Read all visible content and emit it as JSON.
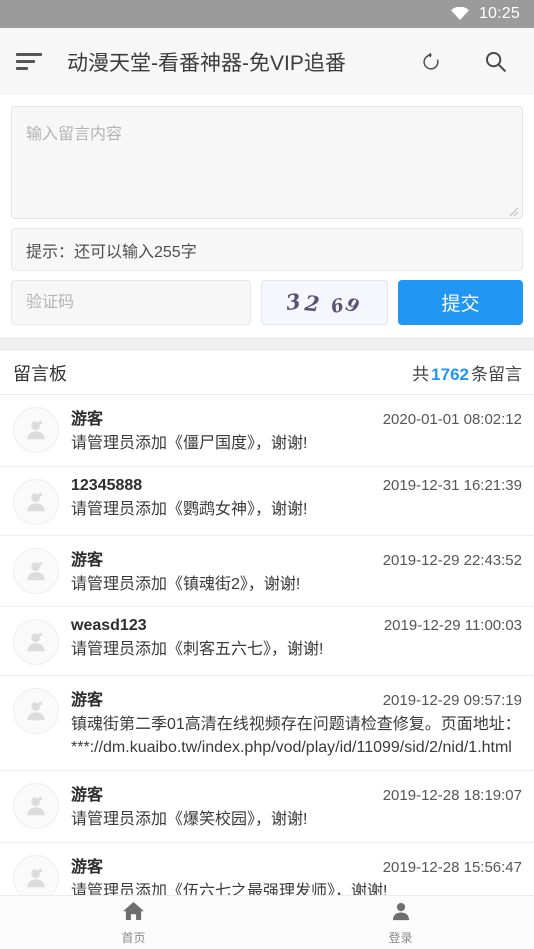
{
  "statusbar": {
    "time": "10:25",
    "wifi_icon": "wifi-icon",
    "bg_color": "#9b9b9b"
  },
  "toolbar": {
    "menu_icon": "hamburger-menu-icon",
    "title": "动漫天堂-看番神器-免VIP追番",
    "refresh_icon": "refresh-icon",
    "search_icon": "search-icon"
  },
  "form": {
    "message_placeholder": "输入留言内容",
    "message_value": "",
    "hint_text": "提示：还可以输入255字",
    "captcha_placeholder": "验证码",
    "captcha_value": "",
    "captcha_code": "3269",
    "captcha_digits": [
      "3",
      "2",
      "6",
      "9"
    ],
    "submit_label": "提交",
    "submit_color": "#2196f3"
  },
  "board": {
    "title": "留言板",
    "count_prefix": "共",
    "count": "1762",
    "count_suffix": "条留言",
    "count_color": "#2196f3",
    "avatar_icon": "user-avatar-icon",
    "messages": [
      {
        "user": "游客",
        "time": "2020-01-01 08:02:12",
        "text": "请管理员添加《僵尸国度》，谢谢!"
      },
      {
        "user": "12345888",
        "time": "2019-12-31 16:21:39",
        "text": "请管理员添加《鹦鹉女神》，谢谢!"
      },
      {
        "user": "游客",
        "time": "2019-12-29 22:43:52",
        "text": "请管理员添加《镇魂街2》，谢谢!"
      },
      {
        "user": "weasd123",
        "time": "2019-12-29 11:00:03",
        "text": "请管理员添加《刺客五六七》，谢谢!"
      },
      {
        "user": "游客",
        "time": "2019-12-29 09:57:19",
        "text": "镇魂街第二季01高清在线视频存在问题请检查修复。页面地址：***://dm.kuaibo.tw/index.php/vod/play/id/11099/sid/2/nid/1.html"
      },
      {
        "user": "游客",
        "time": "2019-12-28 18:19:07",
        "text": "请管理员添加《爆笑校园》，谢谢!"
      },
      {
        "user": "游客",
        "time": "2019-12-28 15:56:47",
        "text": "请管理员添加《伍六七之最强理发师》，谢谢!"
      }
    ]
  },
  "bottomnav": {
    "items": [
      {
        "icon": "home-icon",
        "label": "首页"
      },
      {
        "icon": "person-icon",
        "label": "登录"
      }
    ]
  }
}
